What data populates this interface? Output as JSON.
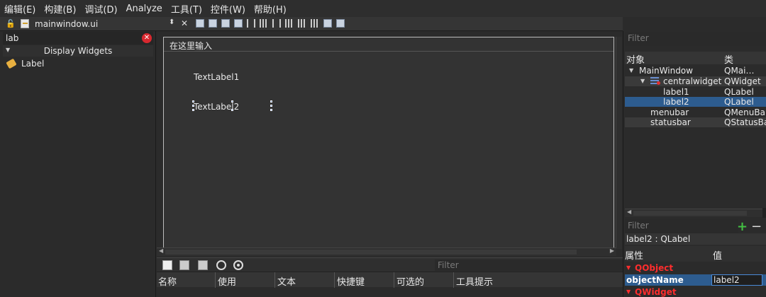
{
  "menubar": [
    "编辑(E)",
    "构建(B)",
    "调试(D)",
    "Analyze",
    "工具(T)",
    "控件(W)",
    "帮助(H)"
  ],
  "filebar": {
    "filename": "mainwindow.ui",
    "lock_icon": "lock-icon",
    "close_symbol": "✕",
    "arrows": "⬍"
  },
  "widgetbox": {
    "search_value": "lab",
    "category": "Display Widgets",
    "items": [
      {
        "label": "Label",
        "icon": "tag-icon"
      }
    ]
  },
  "form": {
    "menu_placeholder": "在这里输入",
    "label1_text": "TextLabel1",
    "label2_text": "TextLabel2"
  },
  "action_editor": {
    "filter_placeholder": "Filter",
    "columns": [
      "名称",
      "使用",
      "文本",
      "快捷键",
      "可选的",
      "工具提示"
    ]
  },
  "object_inspector": {
    "filter_placeholder": "Filter",
    "columns": [
      "对象",
      "类"
    ],
    "rows": [
      {
        "name": "MainWindow",
        "class": "QMai…ndo"
      },
      {
        "name": "centralwidget",
        "class": "QWidget"
      },
      {
        "name": "label1",
        "class": "QLabel"
      },
      {
        "name": "label2",
        "class": "QLabel"
      },
      {
        "name": "menubar",
        "class": "QMenuBar"
      },
      {
        "name": "statusbar",
        "class": "QStatusBar"
      }
    ],
    "selected": "label2"
  },
  "property_editor": {
    "filter_placeholder": "Filter",
    "class_label": "label2 : QLabel",
    "columns": [
      "属性",
      "值"
    ],
    "groups": [
      "QObject",
      "QWidget"
    ],
    "object_name_key": "objectName",
    "object_name_value": "label2"
  },
  "colors": {
    "selection": "#2d5c8f",
    "category_red": "#ff2d2d",
    "accent_green": "#43c043",
    "close_red": "#d8282f"
  }
}
